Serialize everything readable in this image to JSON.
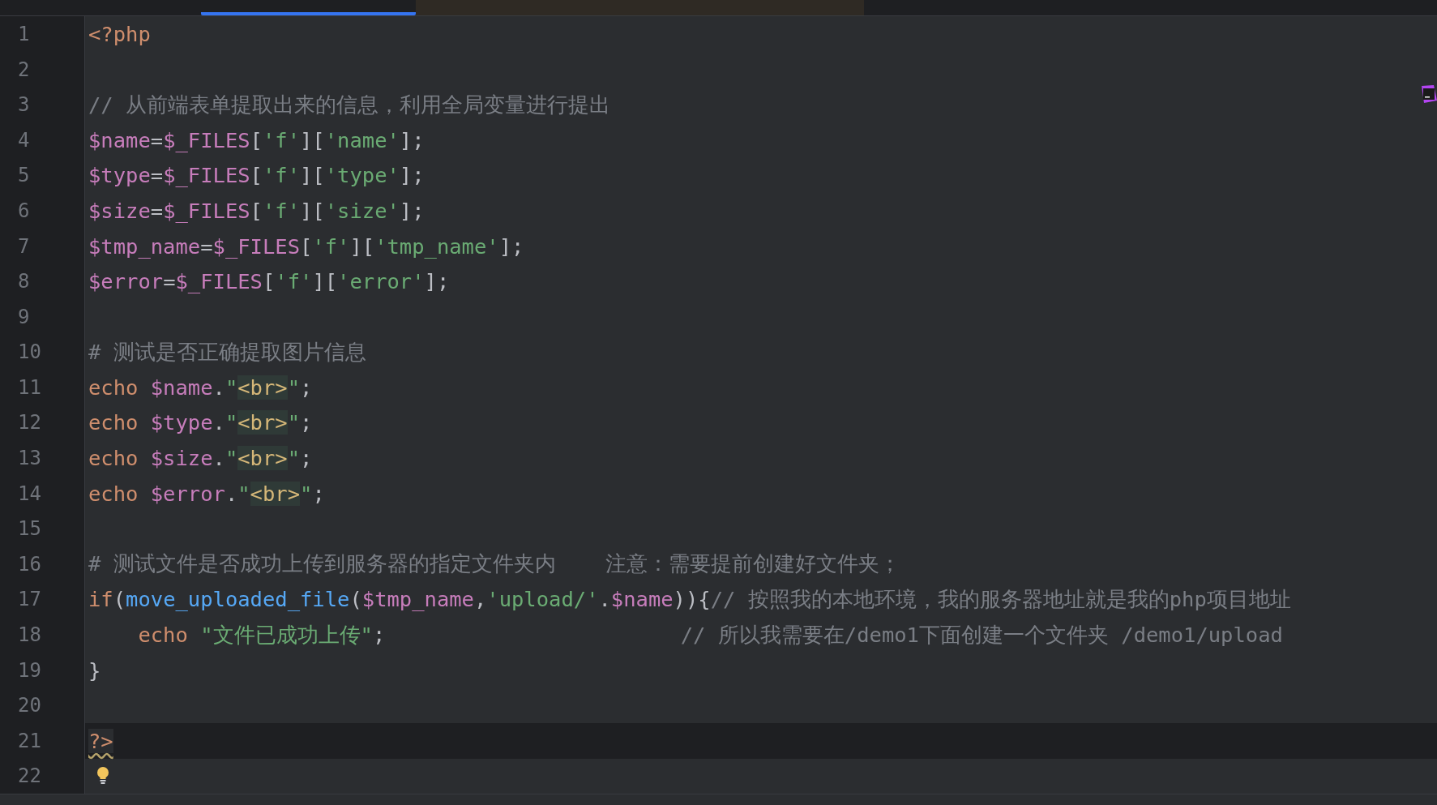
{
  "tabs": [
    {
      "selected": false,
      "modified": false
    },
    {
      "selected": true,
      "modified": false
    },
    {
      "selected": false,
      "modified": true
    }
  ],
  "lines": [
    {
      "number": "1",
      "current": false,
      "tokens": [
        {
          "kind": "tag",
          "text": "<?php"
        }
      ]
    },
    {
      "number": "2",
      "current": false
    },
    {
      "number": "3",
      "current": false,
      "tokens": [
        {
          "kind": "comment",
          "text": "// 从前端表单提取出来的信息，利用全局变量进行提出"
        }
      ]
    },
    {
      "number": "4",
      "current": false,
      "tokens": [
        {
          "kind": "var",
          "text": "$name"
        },
        {
          "kind": "plain",
          "text": "="
        },
        {
          "kind": "var",
          "text": "$_FILES"
        },
        {
          "kind": "plain",
          "text": "["
        },
        {
          "kind": "string",
          "text": "'f'"
        },
        {
          "kind": "plain",
          "text": "]["
        },
        {
          "kind": "string",
          "text": "'name'"
        },
        {
          "kind": "plain",
          "text": "];"
        }
      ]
    },
    {
      "number": "5",
      "current": false,
      "tokens": [
        {
          "kind": "var",
          "text": "$type"
        },
        {
          "kind": "plain",
          "text": "="
        },
        {
          "kind": "var",
          "text": "$_FILES"
        },
        {
          "kind": "plain",
          "text": "["
        },
        {
          "kind": "string",
          "text": "'f'"
        },
        {
          "kind": "plain",
          "text": "]["
        },
        {
          "kind": "string",
          "text": "'type'"
        },
        {
          "kind": "plain",
          "text": "];"
        }
      ]
    },
    {
      "number": "6",
      "current": false,
      "tokens": [
        {
          "kind": "var",
          "text": "$size"
        },
        {
          "kind": "plain",
          "text": "="
        },
        {
          "kind": "var",
          "text": "$_FILES"
        },
        {
          "kind": "plain",
          "text": "["
        },
        {
          "kind": "string",
          "text": "'f'"
        },
        {
          "kind": "plain",
          "text": "]["
        },
        {
          "kind": "string",
          "text": "'size'"
        },
        {
          "kind": "plain",
          "text": "];"
        }
      ]
    },
    {
      "number": "7",
      "current": false,
      "tokens": [
        {
          "kind": "var",
          "text": "$tmp_name"
        },
        {
          "kind": "plain",
          "text": "="
        },
        {
          "kind": "var",
          "text": "$_FILES"
        },
        {
          "kind": "plain",
          "text": "["
        },
        {
          "kind": "string",
          "text": "'f'"
        },
        {
          "kind": "plain",
          "text": "]["
        },
        {
          "kind": "string",
          "text": "'tmp_name'"
        },
        {
          "kind": "plain",
          "text": "];"
        }
      ]
    },
    {
      "number": "8",
      "current": false,
      "tokens": [
        {
          "kind": "var",
          "text": "$error"
        },
        {
          "kind": "plain",
          "text": "="
        },
        {
          "kind": "var",
          "text": "$_FILES"
        },
        {
          "kind": "plain",
          "text": "["
        },
        {
          "kind": "string",
          "text": "'f'"
        },
        {
          "kind": "plain",
          "text": "]["
        },
        {
          "kind": "string",
          "text": "'error'"
        },
        {
          "kind": "plain",
          "text": "];"
        }
      ]
    },
    {
      "number": "9",
      "current": false
    },
    {
      "number": "10",
      "current": false,
      "tokens": [
        {
          "kind": "comment",
          "text": "# 测试是否正确提取图片信息"
        }
      ]
    },
    {
      "number": "11",
      "current": false,
      "tokens": [
        {
          "kind": "keyword",
          "text": "echo "
        },
        {
          "kind": "var",
          "text": "$name"
        },
        {
          "kind": "plain",
          "text": "."
        },
        {
          "kind": "string",
          "text": "\""
        },
        {
          "kind": "html",
          "text": "<br>"
        },
        {
          "kind": "string",
          "text": "\""
        },
        {
          "kind": "plain",
          "text": ";"
        }
      ]
    },
    {
      "number": "12",
      "current": false,
      "tokens": [
        {
          "kind": "keyword",
          "text": "echo "
        },
        {
          "kind": "var",
          "text": "$type"
        },
        {
          "kind": "plain",
          "text": "."
        },
        {
          "kind": "string",
          "text": "\""
        },
        {
          "kind": "html",
          "text": "<br>"
        },
        {
          "kind": "string",
          "text": "\""
        },
        {
          "kind": "plain",
          "text": ";"
        }
      ]
    },
    {
      "number": "13",
      "current": false,
      "tokens": [
        {
          "kind": "keyword",
          "text": "echo "
        },
        {
          "kind": "var",
          "text": "$size"
        },
        {
          "kind": "plain",
          "text": "."
        },
        {
          "kind": "string",
          "text": "\""
        },
        {
          "kind": "html",
          "text": "<br>"
        },
        {
          "kind": "string",
          "text": "\""
        },
        {
          "kind": "plain",
          "text": ";"
        }
      ]
    },
    {
      "number": "14",
      "current": false,
      "tokens": [
        {
          "kind": "keyword",
          "text": "echo "
        },
        {
          "kind": "var",
          "text": "$error"
        },
        {
          "kind": "plain",
          "text": "."
        },
        {
          "kind": "string",
          "text": "\""
        },
        {
          "kind": "html",
          "text": "<br>"
        },
        {
          "kind": "string",
          "text": "\""
        },
        {
          "kind": "plain",
          "text": ";"
        }
      ]
    },
    {
      "number": "15",
      "current": false
    },
    {
      "number": "16",
      "current": false,
      "tokens": [
        {
          "kind": "comment",
          "text": "# 测试文件是否成功上传到服务器的指定文件夹内    注意：需要提前创建好文件夹；"
        }
      ]
    },
    {
      "number": "17",
      "current": false,
      "tokens": [
        {
          "kind": "keyword",
          "text": "if"
        },
        {
          "kind": "plain",
          "text": "("
        },
        {
          "kind": "func",
          "text": "move_uploaded_file"
        },
        {
          "kind": "plain",
          "text": "("
        },
        {
          "kind": "var",
          "text": "$tmp_name"
        },
        {
          "kind": "plain",
          "text": ","
        },
        {
          "kind": "string",
          "text": "'upload/'"
        },
        {
          "kind": "plain",
          "text": "."
        },
        {
          "kind": "var",
          "text": "$name"
        },
        {
          "kind": "plain",
          "text": ")){"
        },
        {
          "kind": "comment",
          "aligned": true,
          "text": "// 按照我的本地环境，我的服务器地址就是我的php项目地址"
        }
      ]
    },
    {
      "number": "18",
      "current": false,
      "tokens": [
        {
          "kind": "indent"
        },
        {
          "kind": "keyword",
          "text": "echo "
        },
        {
          "kind": "string",
          "text": "\"文件已成功上传\""
        },
        {
          "kind": "plain",
          "text": ";"
        },
        {
          "kind": "comment",
          "aligned": true,
          "text": "// 所以我需要在/demo1下面创建一个文件夹 /demo1/upload"
        }
      ]
    },
    {
      "number": "19",
      "current": false,
      "tokens": [
        {
          "kind": "plain",
          "text": "}"
        }
      ]
    },
    {
      "number": "20",
      "current": false
    },
    {
      "number": "21",
      "current": true,
      "tokens": [
        {
          "kind": "tag",
          "text": "?>",
          "warning": true
        }
      ]
    },
    {
      "number": "22",
      "current": false,
      "hint": true
    }
  ]
}
